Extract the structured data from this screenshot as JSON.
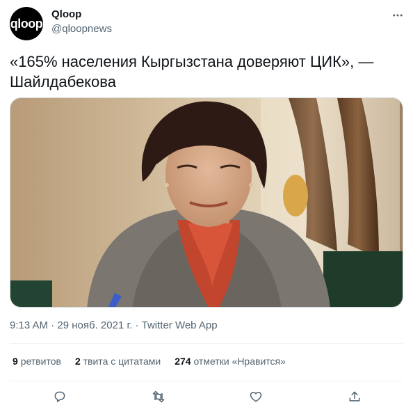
{
  "account": {
    "avatar_text": "qloop",
    "name": "Qloop",
    "handle": "@qloopnews"
  },
  "tweet": {
    "text": "«165% населения Кыргызстана доверяют ЦИК», — Шайлдабекова",
    "time": "9:13 AM",
    "date": "29 нояб. 2021 г.",
    "separator": " · ",
    "source": "Twitter Web App"
  },
  "stats": {
    "retweets_count": "9",
    "retweets_label": "ретвитов",
    "quotes_count": "2",
    "quotes_label": "твита с цитатами",
    "likes_count": "274",
    "likes_label": "отметки «Нравится»"
  },
  "icons": {
    "more": "more-dots-icon",
    "reply": "reply-icon",
    "retweet": "retweet-icon",
    "like": "heart-icon",
    "share": "share-icon"
  },
  "colors": {
    "text": "#0f1419",
    "secondary": "#536471",
    "border": "#eff3f4"
  }
}
